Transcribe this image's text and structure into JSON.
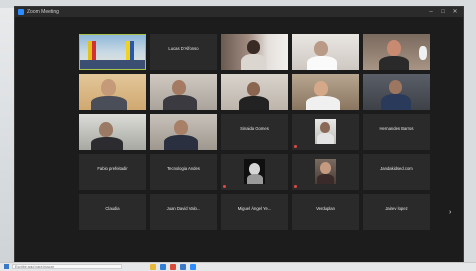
{
  "window": {
    "title": "Zoom Meeting"
  },
  "participants": [
    {
      "id": "p1",
      "name": "",
      "type": "video",
      "active": true
    },
    {
      "id": "p2",
      "name": "Lucas D'Alfonso",
      "type": "name"
    },
    {
      "id": "p3",
      "name": "",
      "type": "video"
    },
    {
      "id": "p4",
      "name": "",
      "type": "video"
    },
    {
      "id": "p5",
      "name": "",
      "type": "video"
    },
    {
      "id": "p6",
      "name": "",
      "type": "video"
    },
    {
      "id": "p7",
      "name": "",
      "type": "video"
    },
    {
      "id": "p8",
      "name": "",
      "type": "video"
    },
    {
      "id": "p9",
      "name": "",
      "type": "video"
    },
    {
      "id": "p10",
      "name": "",
      "type": "video"
    },
    {
      "id": "p11",
      "name": "",
      "type": "video"
    },
    {
      "id": "p12",
      "name": "",
      "type": "video"
    },
    {
      "id": "p13",
      "name": "Sinaida Gomes",
      "type": "name"
    },
    {
      "id": "p14",
      "name": "",
      "type": "picture"
    },
    {
      "id": "p15",
      "name": "Hernandes Barros",
      "type": "name"
    },
    {
      "id": "p16",
      "name": "Fabio prefeitadir",
      "type": "name"
    },
    {
      "id": "p17",
      "name": "Tecnologia Andes",
      "type": "name"
    },
    {
      "id": "p18",
      "name": "",
      "type": "picture"
    },
    {
      "id": "p19",
      "name": "",
      "type": "picture"
    },
    {
      "id": "p20",
      "name": "Jandakidsed.com",
      "type": "name"
    },
    {
      "id": "p21",
      "name": "Claudia",
      "type": "name"
    },
    {
      "id": "p22",
      "name": "Juan David Valo...",
      "type": "name"
    },
    {
      "id": "p23",
      "name": "Miguel Ángel Ye...",
      "type": "name"
    },
    {
      "id": "p24",
      "name": "Verduplan",
      "type": "name"
    },
    {
      "id": "p25",
      "name": "Jairev lopez",
      "type": "name"
    }
  ],
  "taskbar": {
    "search_placeholder": "Escribe aquí para buscar"
  },
  "colors": {
    "window_bg": "#1c1c1c",
    "tile_bg": "#2a2a2a",
    "active_border": "#a8c34a",
    "mic_off": "#e04848"
  },
  "icons": [
    "zoom-app-icon",
    "minimize-icon",
    "maximize-icon",
    "close-icon",
    "muted-mic-icon",
    "share-arrow-icon",
    "windows-start-icon"
  ]
}
